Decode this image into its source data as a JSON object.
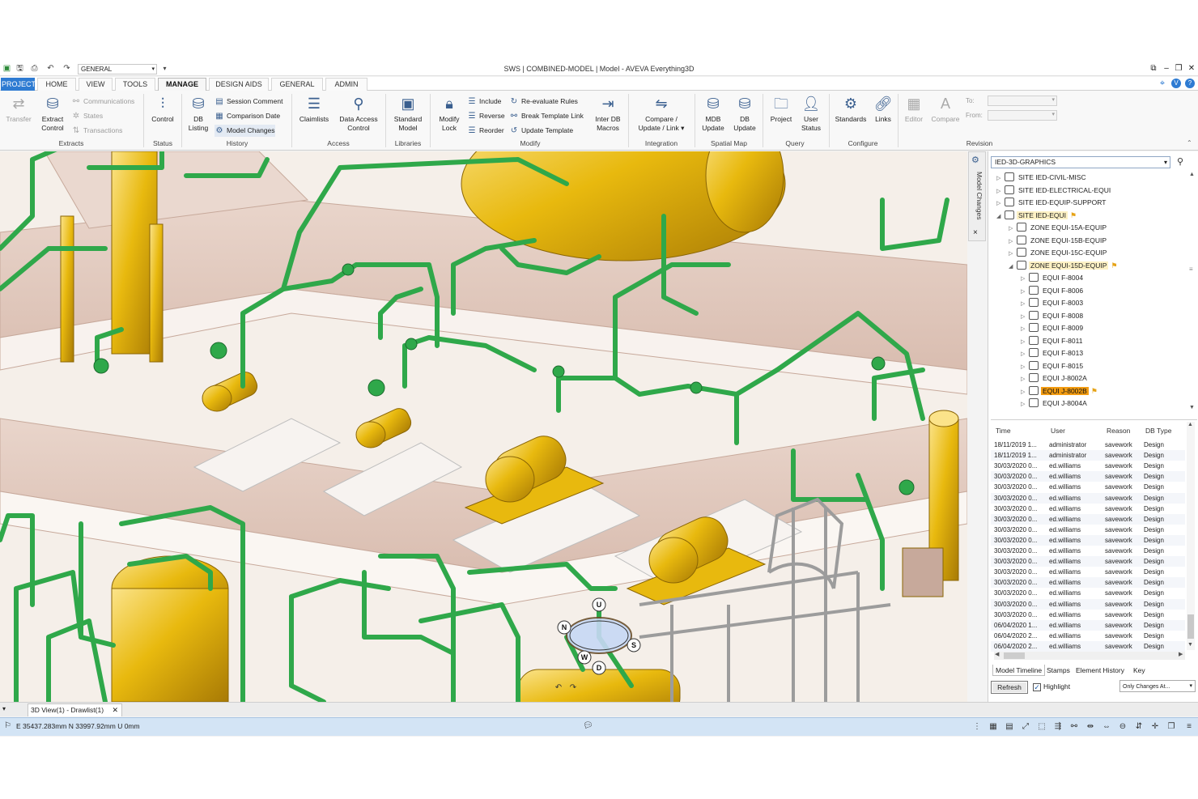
{
  "window": {
    "title": "SWS | COMBINED-MODEL | Model - AVEVA Everything3D",
    "qat_combo_value": "GENERAL"
  },
  "tabs": [
    "PROJECT",
    "HOME",
    "VIEW",
    "TOOLS",
    "MANAGE",
    "DESIGN AIDS",
    "GENERAL",
    "ADMIN"
  ],
  "active_tab": "MANAGE",
  "ribbon": {
    "transfer": "Transfer",
    "extract_control": [
      "Extract",
      "Control"
    ],
    "communications": "Communications",
    "states": "States",
    "transactions": "Transactions",
    "extracts_group": "Extracts",
    "control": "Control",
    "status_group": "Status",
    "db_listing": [
      "DB",
      "Listing"
    ],
    "session_comment": "Session Comment",
    "comparison_date": "Comparison Date",
    "model_changes": "Model Changes",
    "history_group": "History",
    "claimlists": "Claimlists",
    "data_access_control": [
      "Data Access",
      "Control"
    ],
    "access_group": "Access",
    "standard_model": [
      "Standard",
      "Model"
    ],
    "libraries_group": "Libraries",
    "modify_lock": [
      "Modify",
      "Lock"
    ],
    "include": "Include",
    "reverse": "Reverse",
    "reorder": "Reorder",
    "reevaluate_rules": "Re-evaluate Rules",
    "break_template_link": "Break Template Link",
    "update_template": "Update Template",
    "inter_db_macros": [
      "Inter DB",
      "Macros"
    ],
    "modify_group": "Modify",
    "compare_update_link": [
      "Compare /",
      "Update / Link"
    ],
    "integration_group": "Integration",
    "mdb_update": [
      "MDB",
      "Update"
    ],
    "db_update": [
      "DB",
      "Update"
    ],
    "spatial_map_group": "Spatial Map",
    "project": "Project",
    "user_status": [
      "User",
      "Status"
    ],
    "query_group": "Query",
    "standards": "Standards",
    "links": "Links",
    "configure_group": "Configure",
    "editor": "Editor",
    "compare": "Compare",
    "to_label": "To:",
    "from_label": "From:",
    "revision_group": "Revision"
  },
  "side_strip": {
    "label": "Model Changes",
    "close": "×"
  },
  "tree": {
    "combo_value": "IED-3D-GRAPHICS",
    "items": [
      {
        "label": "SITE IED-CIVIL-MISC",
        "level": 1,
        "expander": "▷",
        "state": "normal"
      },
      {
        "label": "SITE IED-ELECTRICAL-EQUI",
        "level": 1,
        "expander": "▷",
        "state": "normal"
      },
      {
        "label": "SITE IED-EQUIP-SUPPORT",
        "level": 1,
        "expander": "▷",
        "state": "normal"
      },
      {
        "label": "SITE IED-EQUI",
        "level": 1,
        "expander": "◢",
        "state": "yellow",
        "flag": true
      },
      {
        "label": "ZONE EQUI-15A-EQUIP",
        "level": 2,
        "expander": "▷",
        "state": "normal"
      },
      {
        "label": "ZONE EQUI-15B-EQUIP",
        "level": 2,
        "expander": "▷",
        "state": "normal"
      },
      {
        "label": "ZONE EQUI-15C-EQUIP",
        "level": 2,
        "expander": "▷",
        "state": "normal"
      },
      {
        "label": "ZONE EQUI-15D-EQUIP",
        "level": 2,
        "expander": "◢",
        "state": "yellow",
        "flag": true
      },
      {
        "label": "EQUI F-8004",
        "level": 3,
        "expander": "▷",
        "state": "normal"
      },
      {
        "label": "EQUI F-8006",
        "level": 3,
        "expander": "▷",
        "state": "normal"
      },
      {
        "label": "EQUI F-8003",
        "level": 3,
        "expander": "▷",
        "state": "normal"
      },
      {
        "label": "EQUI F-8008",
        "level": 3,
        "expander": "▷",
        "state": "normal"
      },
      {
        "label": "EQUI F-8009",
        "level": 3,
        "expander": "▷",
        "state": "normal"
      },
      {
        "label": "EQUI F-8011",
        "level": 3,
        "expander": "▷",
        "state": "normal"
      },
      {
        "label": "EQUI F-8013",
        "level": 3,
        "expander": "▷",
        "state": "normal"
      },
      {
        "label": "EQUI F-8015",
        "level": 3,
        "expander": "▷",
        "state": "normal"
      },
      {
        "label": "EQUI J-8002A",
        "level": 3,
        "expander": "▷",
        "state": "normal"
      },
      {
        "label": "EQUI J-8002B",
        "level": 3,
        "expander": "▷",
        "state": "selected",
        "flag": true
      },
      {
        "label": "EQUI J-8004A",
        "level": 3,
        "expander": "▷",
        "state": "normal"
      }
    ]
  },
  "timeline": {
    "columns": [
      "Time",
      "User",
      "Reason",
      "DB Type"
    ],
    "rows": [
      [
        "18/11/2019 1...",
        "administrator",
        "savework",
        "Design"
      ],
      [
        "18/11/2019 1...",
        "administrator",
        "savework",
        "Design"
      ],
      [
        "30/03/2020 0...",
        "ed.williams",
        "savework",
        "Design"
      ],
      [
        "30/03/2020 0...",
        "ed.williams",
        "savework",
        "Design"
      ],
      [
        "30/03/2020 0...",
        "ed.williams",
        "savework",
        "Design"
      ],
      [
        "30/03/2020 0...",
        "ed.williams",
        "savework",
        "Design"
      ],
      [
        "30/03/2020 0...",
        "ed.williams",
        "savework",
        "Design"
      ],
      [
        "30/03/2020 0...",
        "ed.williams",
        "savework",
        "Design"
      ],
      [
        "30/03/2020 0...",
        "ed.williams",
        "savework",
        "Design"
      ],
      [
        "30/03/2020 0...",
        "ed.williams",
        "savework",
        "Design"
      ],
      [
        "30/03/2020 0...",
        "ed.williams",
        "savework",
        "Design"
      ],
      [
        "30/03/2020 0...",
        "ed.williams",
        "savework",
        "Design"
      ],
      [
        "30/03/2020 0...",
        "ed.williams",
        "savework",
        "Design"
      ],
      [
        "30/03/2020 0...",
        "ed.williams",
        "savework",
        "Design"
      ],
      [
        "30/03/2020 0...",
        "ed.williams",
        "savework",
        "Design"
      ],
      [
        "30/03/2020 0...",
        "ed.williams",
        "savework",
        "Design"
      ],
      [
        "30/03/2020 0...",
        "ed.williams",
        "savework",
        "Design"
      ],
      [
        "06/04/2020 1...",
        "ed.williams",
        "savework",
        "Design"
      ],
      [
        "06/04/2020 2...",
        "ed.williams",
        "savework",
        "Design"
      ],
      [
        "06/04/2020 2...",
        "ed.williams",
        "savework",
        "Design"
      ]
    ]
  },
  "panel_tabs": [
    "Model Timeline",
    "Stamps",
    "Element History",
    "Key"
  ],
  "active_panel_tab": "Model Timeline",
  "refresh_label": "Refresh",
  "highlight_label": "Highlight",
  "highlight_checked": true,
  "changes_filter": "Only Changes At...",
  "doc_tab": "3D View(1) - Drawlist(1)",
  "status": {
    "coords": "E 35437.283mm N 33997.92mm U 0mm"
  },
  "compass": {
    "labels": [
      "U",
      "N",
      "S",
      "W",
      "D"
    ]
  },
  "colors": {
    "project_tab": "#2e7bd2",
    "selected_item": "#f39c12",
    "status_bar": "#d3e4f5",
    "pipe_green": "#2fa84a",
    "equipment_yellow": "#e8b90e"
  }
}
